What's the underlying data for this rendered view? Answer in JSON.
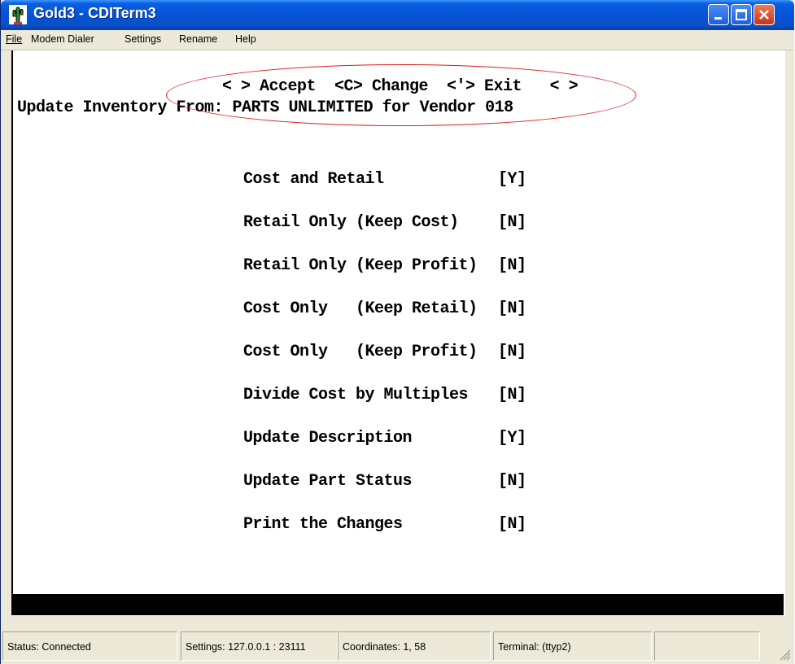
{
  "window": {
    "title": "Gold3 - CDITerm3",
    "icon": "cactus-app-icon",
    "controls": [
      "minimize",
      "maximize",
      "close"
    ]
  },
  "menu": [
    {
      "label": "File"
    },
    {
      "label": "Modem Dialer"
    },
    {
      "label": "Settings"
    },
    {
      "label": "Rename"
    },
    {
      "label": "Help"
    }
  ],
  "terminal": {
    "hint_line": "< > Accept  <C> Change  <'> Exit   < >",
    "header": "Update Inventory From: PARTS UNLIMITED for Vendor 018",
    "options": [
      {
        "label": "Cost and Retail",
        "value": "[Y]"
      },
      {
        "label": "Retail Only (Keep Cost)",
        "value": "[N]"
      },
      {
        "label": "Retail Only (Keep Profit)",
        "value": "[N]"
      },
      {
        "label": "Cost Only   (Keep Retail)",
        "value": "[N]"
      },
      {
        "label": "Cost Only   (Keep Profit)",
        "value": "[N]"
      },
      {
        "label": "Divide Cost by Multiples",
        "value": "[N]"
      },
      {
        "label": "Update Description",
        "value": "[Y]"
      },
      {
        "label": "Update Part Status",
        "value": "[N]"
      },
      {
        "label": "Print the Changes",
        "value": "[N]"
      }
    ],
    "annotation_color": "#e21b1b"
  },
  "status": {
    "status": "Status:  Connected",
    "settings": "Settings: 127.0.0.1 : 23111",
    "coordinates": "Coordinates:    1, 58",
    "terminal": "Terminal: (ttyp2)"
  }
}
